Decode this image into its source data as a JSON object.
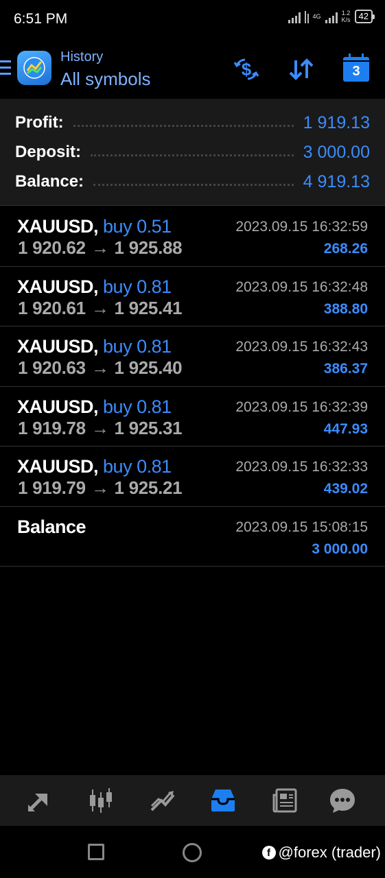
{
  "status_bar": {
    "time": "6:51 PM",
    "network": "4G",
    "speed_value": "1.2",
    "speed_unit": "K/s",
    "battery": "42"
  },
  "header": {
    "subtitle": "History",
    "title": "All symbols",
    "calendar_badge": "3",
    "icons": [
      "menu-icon",
      "app-logo",
      "dollar-exchange-icon",
      "sort-icon",
      "calendar-icon"
    ]
  },
  "summary": {
    "profit_label": "Profit:",
    "profit_value": "1 919.13",
    "deposit_label": "Deposit:",
    "deposit_value": "3 000.00",
    "balance_label": "Balance:",
    "balance_value": "4 919.13"
  },
  "deals": [
    {
      "symbol": "XAUUSD,",
      "type": "buy 0.51",
      "open": "1 920.62",
      "arrow": "→",
      "close": "1 925.88",
      "time": "2023.09.15 16:32:59",
      "profit": "268.26"
    },
    {
      "symbol": "XAUUSD,",
      "type": "buy 0.81",
      "open": "1 920.61",
      "arrow": "→",
      "close": "1 925.41",
      "time": "2023.09.15 16:32:48",
      "profit": "388.80"
    },
    {
      "symbol": "XAUUSD,",
      "type": "buy 0.81",
      "open": "1 920.63",
      "arrow": "→",
      "close": "1 925.40",
      "time": "2023.09.15 16:32:43",
      "profit": "386.37"
    },
    {
      "symbol": "XAUUSD,",
      "type": "buy 0.81",
      "open": "1 919.78",
      "arrow": "→",
      "close": "1 925.31",
      "time": "2023.09.15 16:32:39",
      "profit": "447.93"
    },
    {
      "symbol": "XAUUSD,",
      "type": "buy 0.81",
      "open": "1 919.79",
      "arrow": "→",
      "close": "1 925.21",
      "time": "2023.09.15 16:32:33",
      "profit": "439.02"
    }
  ],
  "balance_entry": {
    "label": "Balance",
    "time": "2023.09.15 15:08:15",
    "amount": "3 000.00"
  },
  "bottom_nav": {
    "items": [
      "quotes-icon",
      "chart-icon",
      "trade-icon",
      "history-icon",
      "news-icon",
      "chat-icon"
    ],
    "active": "history-icon",
    "active_color": "#1d7ef0"
  },
  "watermark": {
    "text": "@forex (trader)"
  },
  "colors": {
    "accent": "#3b8cff",
    "title": "#7fb2ff",
    "background": "#000000",
    "summary_bg": "#1a1a1a"
  }
}
